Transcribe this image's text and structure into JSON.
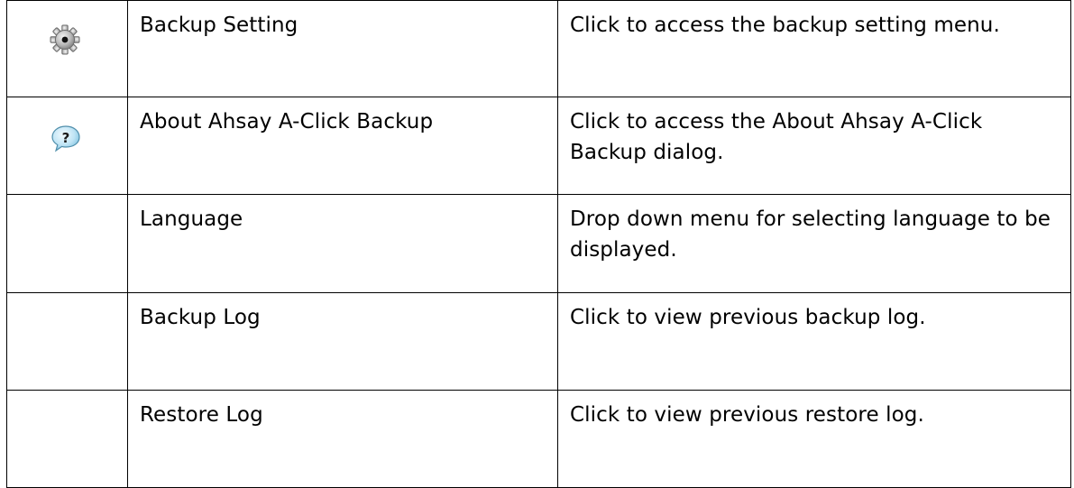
{
  "rows": [
    {
      "icon": "gear-icon",
      "name": "Backup Setting",
      "description": "Click to access the backup setting menu."
    },
    {
      "icon": "help-speech-bubble-icon",
      "name": "About Ahsay A-Click Backup",
      "description": "Click to access the About Ahsay A-Click Backup dialog."
    },
    {
      "icon": "",
      "name": "Language",
      "description": "Drop down menu for selecting language to be displayed."
    },
    {
      "icon": "",
      "name": "Backup Log",
      "description": "Click to view previous backup log."
    },
    {
      "icon": "",
      "name": "Restore Log",
      "description": "Click to view previous restore log."
    }
  ]
}
